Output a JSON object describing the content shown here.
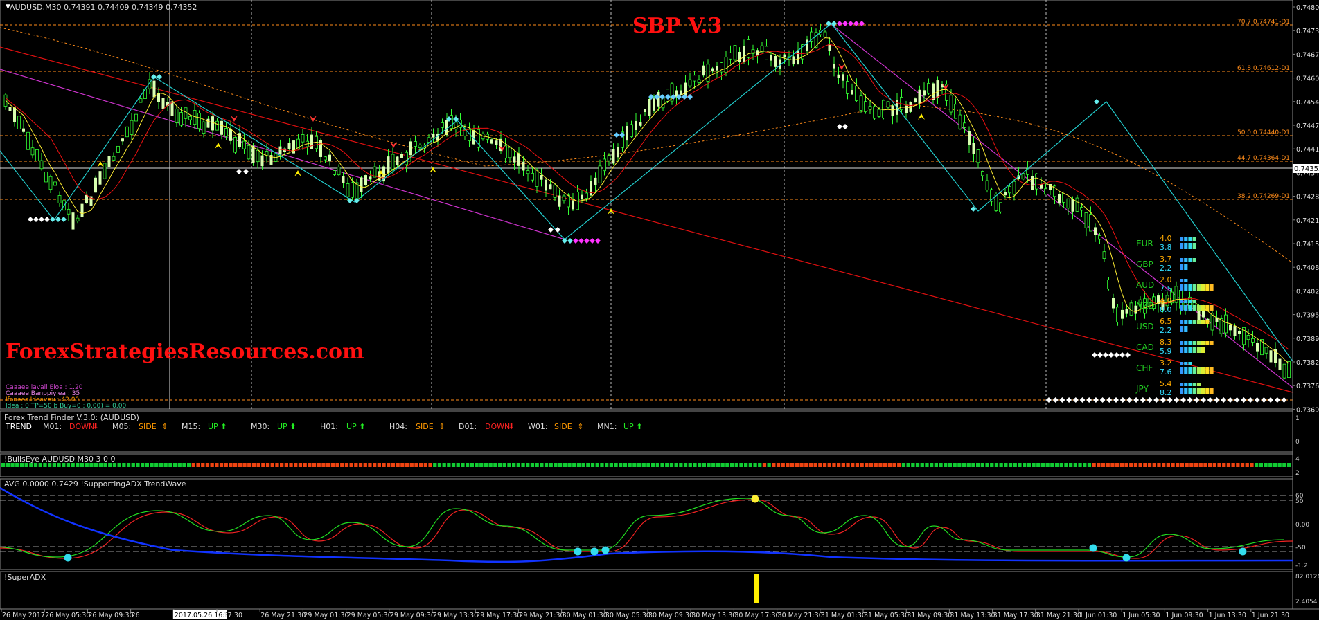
{
  "window": {
    "symbol_header": "AUDUSD,M30  0.74391 0.74409 0.74349 0.74352",
    "indicator_title": "SBP V.3",
    "watermark": "ForexStrategiesResources.com"
  },
  "price_axis": {
    "labels": [
      "0.74800",
      "0.74735",
      "0.74670",
      "0.74605",
      "0.74540",
      "0.74475",
      "0.74410",
      "0.74345",
      "0.74280",
      "0.74215",
      "0.74150",
      "0.74085",
      "0.74020",
      "0.73955",
      "0.73890",
      "0.73825",
      "0.73760",
      "0.73695"
    ],
    "current_price": "0.74352"
  },
  "fib_levels": [
    {
      "label": "70.7  0.74741-D1"
    },
    {
      "label": "61.8  0.74612-D1"
    },
    {
      "label": "50.0  0.74440-D1"
    },
    {
      "label": "44.7  0.74364-D1"
    },
    {
      "label": "38.2  0.74269-D1"
    }
  ],
  "info_lines": [
    "Caaaee iavaii Eioa : 1.20",
    "Caaaee Banppiyiea : 35",
    "Ifonees Ideaveu : 42.00",
    "Idea : 0 TP=50 b Buy=0 : 0.00) = 0.00"
  ],
  "currency_strength": [
    {
      "name": "EUR",
      "v1": "4.0",
      "v2": "3.8",
      "c1": "#ffaa00",
      "c2": "#33ddff"
    },
    {
      "name": "GBP",
      "v1": "3.7",
      "v2": "2.2",
      "c1": "#ffaa00",
      "c2": "#33ddff"
    },
    {
      "name": "AUD",
      "v1": "2.0",
      "v2": "7.5",
      "c1": "#ffaa00",
      "c2": "#33ddff"
    },
    {
      "name": "NZD",
      "v1": "4.0",
      "v2": "8.0",
      "c1": "#ffaa00",
      "c2": "#33ddff"
    },
    {
      "name": "USD",
      "v1": "6.5",
      "v2": "2.2",
      "c1": "#ffaa00",
      "c2": "#33ddff"
    },
    {
      "name": "CAD",
      "v1": "8.3",
      "v2": "5.9",
      "c1": "#ffaa00",
      "c2": "#33ddff"
    },
    {
      "name": "CHF",
      "v1": "3.2",
      "v2": "7.6",
      "c1": "#ffaa00",
      "c2": "#33ddff"
    },
    {
      "name": "JPY",
      "v1": "5.4",
      "v2": "8.2",
      "c1": "#ffaa00",
      "c2": "#33ddff"
    }
  ],
  "trend_finder": {
    "title": "Forex Trend Finder V.3.0: (AUDUSD)",
    "label": "TREND",
    "items": [
      {
        "tf": "M01:",
        "state": "DOWN",
        "arrow": "⬇",
        "color": "#ff2222"
      },
      {
        "tf": "M05:",
        "state": "SIDE",
        "arrow": "⇕",
        "color": "#ff9900"
      },
      {
        "tf": "M15:",
        "state": "UP",
        "arrow": "⬆",
        "color": "#22ee22"
      },
      {
        "tf": "M30:",
        "state": "UP",
        "arrow": "⬆",
        "color": "#22ee22"
      },
      {
        "tf": "H01:",
        "state": "UP",
        "arrow": "⬆",
        "color": "#22ee22"
      },
      {
        "tf": "H04:",
        "state": "SIDE",
        "arrow": "⇕",
        "color": "#ff9900"
      },
      {
        "tf": "D01:",
        "state": "DOWN",
        "arrow": "⬇",
        "color": "#ff2222"
      },
      {
        "tf": "W01:",
        "state": "SIDE",
        "arrow": "⇕",
        "color": "#ff9900"
      },
      {
        "tf": "MN1:",
        "state": "UP",
        "arrow": "⬆",
        "color": "#22ee22"
      }
    ],
    "axis": [
      "1",
      "0"
    ]
  },
  "bullseye": {
    "title": "!BullsEye AUDUSD M30 3 0 0",
    "axis": [
      "4",
      "2"
    ]
  },
  "adx_panel": {
    "title": "AVG 0.0000 0.7429  !SupportingADX  TrendWave",
    "axis": [
      "60",
      "50",
      "0.00",
      "-50",
      "-1.2"
    ]
  },
  "superadx": {
    "title": "!SuperADX",
    "axis": [
      "82.0126",
      "2.4054"
    ]
  },
  "time_axis": {
    "labels": [
      "26 May 2017",
      "26 May 05:30",
      "26 May 09:30",
      "26",
      "2017.05.26 16:30",
      "y 17:30",
      "26 May 21:30",
      "29 May 01:30",
      "29 May 05:30",
      "29 May 09:30",
      "29 May 13:30",
      "29 May 17:30",
      "29 May 21:30",
      "30 May 01:30",
      "30 May 05:30",
      "30 May 09:30",
      "30 May 13:30",
      "30 May 17:30",
      "30 May 21:30",
      "31 May 01:30",
      "31 May 05:30",
      "31 May 09:30",
      "31 May 13:30",
      "31 May 17:30",
      "31 May 21:30",
      "1 Jun 01:30",
      "1 Jun 05:30",
      "1 Jun 09:30",
      "1 Jun 13:30",
      "1 Jun 21:30"
    ]
  },
  "colors": {
    "bull_candle": "#d8ffb0",
    "wick": "#33ff33",
    "fib": "#ff8c1a",
    "zigzag": "#22cccc",
    "trendline_red": "#e01010",
    "trendline_magenta": "#cc33cc",
    "ma_yellow": "#ffee33",
    "ma_red": "#ee1111",
    "title_red": "#ff1010",
    "bullseye_green": "#11cc33",
    "bullseye_red": "#ee4411",
    "adx_blue": "#1133ff"
  }
}
